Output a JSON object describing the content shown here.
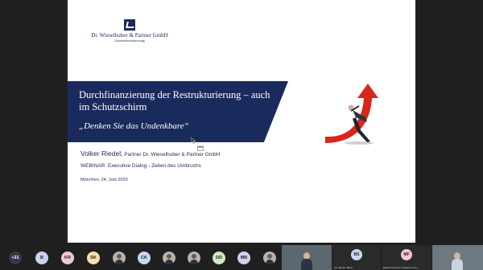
{
  "slide": {
    "logo_name": "Dr. Wieselhuber & Partner GmbH",
    "logo_sub": "Unternehmensberatung",
    "title": "Durchfinanzierung der Restrukturierung – auch im Schutzschirm",
    "quote": "„Denken Sie das Undenkbare“",
    "speaker_name": "Volker Riedel,",
    "speaker_role": " Partner Dr. Wieselhuber & Partner GmbH",
    "webinar": "WEBINAR: Executive Dialog - Zeiten des Umbruchs",
    "place_date": "München, 24. Juni 2020",
    "brand_color": "#1b2a5c",
    "arrow_color": "#d9261c"
  },
  "participants": {
    "overflow": "+31",
    "initials": [
      "B",
      "KR",
      "SK",
      "CK",
      "DD",
      "MB"
    ],
    "colors": [
      "#c9d3f0",
      "#f3c7d4",
      "#f7e0a8",
      "#c8d8f2",
      "#cfe8c4",
      "#d9cef0"
    ],
    "tiles": [
      {
        "initials": "BS",
        "name": "von Sachs, Britta",
        "color": "#c8d8f2"
      },
      {
        "initials": "MF",
        "name": "Martin Franssen  Linkedin a.com",
        "color": "#f3c7d4"
      }
    ]
  }
}
